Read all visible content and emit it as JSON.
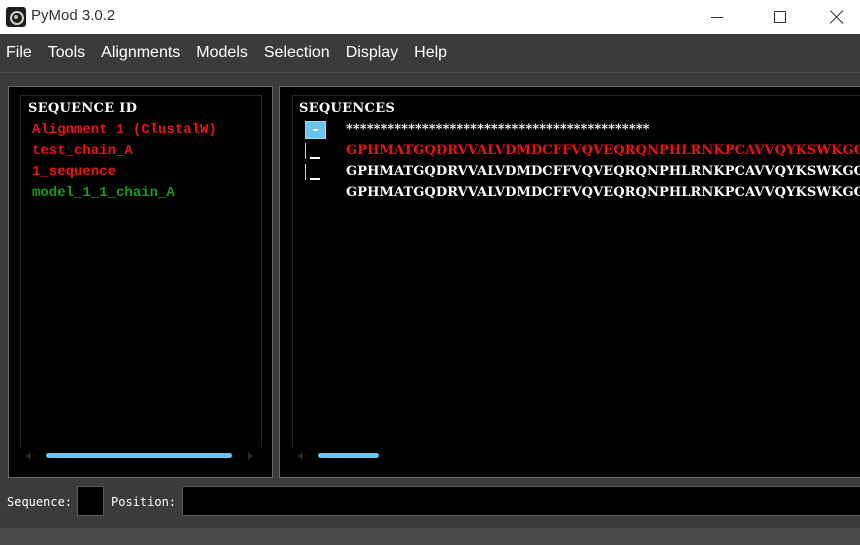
{
  "window": {
    "title": "PyMod 3.0.2"
  },
  "menu": [
    "File",
    "Tools",
    "Alignments",
    "Models",
    "Selection",
    "Display",
    "Help"
  ],
  "left_panel": {
    "header": "SEQUENCE ID",
    "items": [
      {
        "label": "Alignment 1 (ClustalW)",
        "color": "#ee1111"
      },
      {
        "label": "test_chain_A",
        "color": "#ee1111"
      },
      {
        "label": "1_sequence",
        "color": "#ee1111"
      },
      {
        "label": "model_1_1_chain_A",
        "color": "#1a9a1a"
      }
    ]
  },
  "right_panel": {
    "header": "SEQUENCES",
    "collapse_symbol": "-",
    "conservation": "********************************************",
    "rows": [
      {
        "sequence": "GPHMATGQDRVVALVDMDCFFVQVEQRQNPHLRNKPCAVVQYKSWKGGGI",
        "color": "#ee1111"
      },
      {
        "sequence": "GPHMATGQDRVVALVDMDCFFVQVEQRQNPHLRNKPCAVVQYKSWKGGGI",
        "color": "#ffffff"
      },
      {
        "sequence": "GPHMATGQDRVVALVDMDCFFVQVEQRQNPHLRNKPCAVVQYKSWKGGGI",
        "color": "#ffffff"
      }
    ]
  },
  "status": {
    "sequence_label": "Sequence:",
    "sequence_value": "",
    "position_label": "Position:",
    "position_value": ""
  },
  "colors": {
    "accent": "#6bc4f0",
    "background": "#3b3b3b",
    "panel": "#000000"
  }
}
